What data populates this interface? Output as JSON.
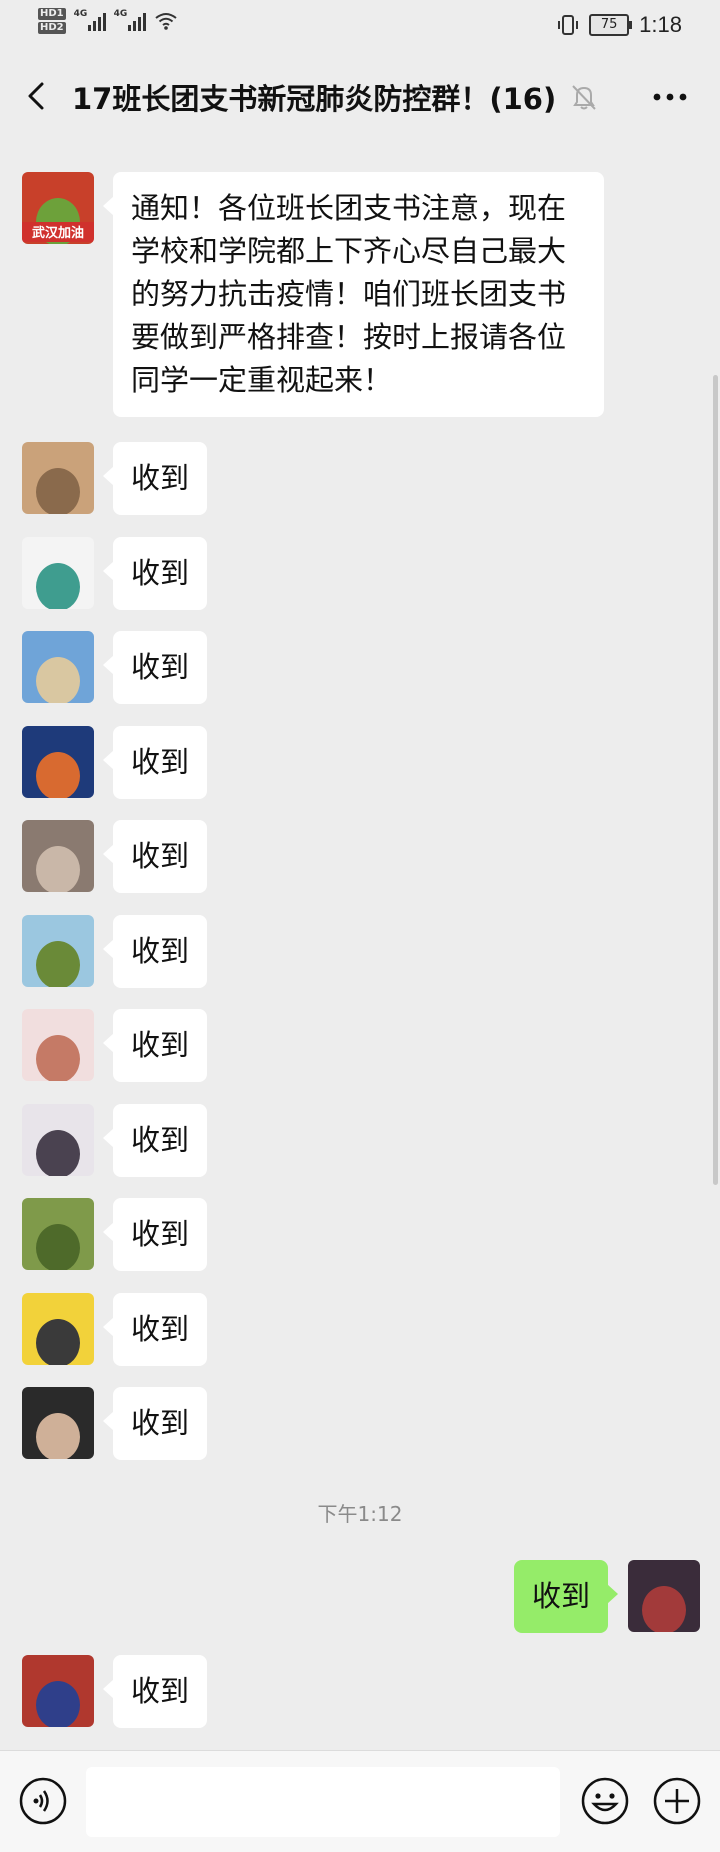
{
  "status_bar": {
    "hd1": "HD1",
    "hd2": "HD2",
    "net1": "4G",
    "net2": "4G",
    "battery": "75",
    "time": "1:18"
  },
  "header": {
    "title": "17班长团支书新冠肺炎防控群！(16)",
    "icons": [
      "back-icon",
      "mute-icon",
      "more-icon"
    ]
  },
  "messages": [
    {
      "side": "left",
      "text": "通知！各位班长团支书注意，现在\n学校和学院都上下齐心尽自己最大\n的努力抗击疫情！咱们班长团支书\n要做到严格排查！按时上报请各位\n同学一定重视起来！",
      "avatar_colors": [
        "#c8402a",
        "#6da13a"
      ],
      "avatar_text": "武汉加油"
    },
    {
      "side": "left",
      "text": "收到",
      "avatar_colors": [
        "#caa27a",
        "#8a6a4c"
      ]
    },
    {
      "side": "left",
      "text": "收到",
      "avatar_colors": [
        "#f4f4f4",
        "#3f9d8f"
      ]
    },
    {
      "side": "left",
      "text": "收到",
      "avatar_colors": [
        "#6fa4d8",
        "#d9c7a1"
      ]
    },
    {
      "side": "left",
      "text": "收到",
      "avatar_colors": [
        "#1e3a7a",
        "#d86a30"
      ]
    },
    {
      "side": "left",
      "text": "收到",
      "avatar_colors": [
        "#8a7a70",
        "#c9b7a8"
      ]
    },
    {
      "side": "left",
      "text": "收到",
      "avatar_colors": [
        "#9bc7e0",
        "#6a8a38"
      ]
    },
    {
      "side": "left",
      "text": "收到",
      "avatar_colors": [
        "#f1dede",
        "#c57a66"
      ]
    },
    {
      "side": "left",
      "text": "收到",
      "avatar_colors": [
        "#e8e4ea",
        "#4a4250"
      ]
    },
    {
      "side": "left",
      "text": "收到",
      "avatar_colors": [
        "#7f9a4a",
        "#4e6a2a"
      ]
    },
    {
      "side": "left",
      "text": "收到",
      "avatar_colors": [
        "#f2d23a",
        "#3a3a3a"
      ]
    },
    {
      "side": "left",
      "text": "收到",
      "avatar_colors": [
        "#2a2a2a",
        "#cfb098"
      ]
    }
  ],
  "timestamp": "下午1:12",
  "my_message": {
    "side": "right",
    "text": "收到",
    "avatar_colors": [
      "#3a2c3a",
      "#a23a3a"
    ]
  },
  "last_message": {
    "side": "left",
    "text": "收到",
    "avatar_colors": [
      "#b0382e",
      "#2f3f8a"
    ]
  },
  "input_bar": {
    "input_value": "",
    "icons": [
      "voice-icon",
      "emoji-icon",
      "plus-icon"
    ]
  },
  "colors": {
    "background": "#ededed",
    "bubble_left": "#ffffff",
    "bubble_right": "#95ec69"
  }
}
